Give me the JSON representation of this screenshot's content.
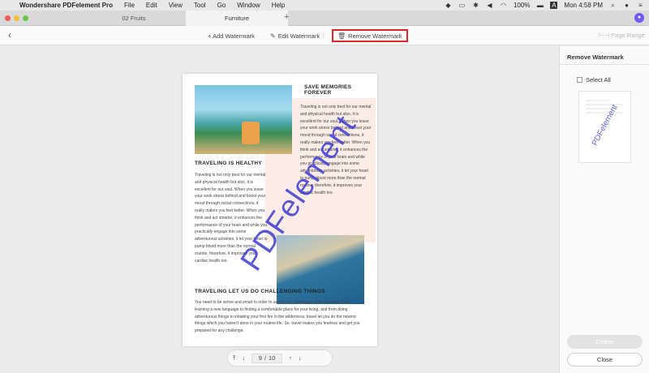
{
  "menubar": {
    "app_name": "Wondershare PDFelement Pro",
    "items": [
      "File",
      "Edit",
      "View",
      "Tool",
      "Go",
      "Window",
      "Help"
    ],
    "battery": "100%",
    "clock": "Mon 4:58 PM",
    "input_source": "A"
  },
  "tabs": [
    {
      "label": "02 Fruits"
    },
    {
      "label": "Furniture"
    }
  ],
  "toolbar": {
    "add_watermark": "+ Add Watermark",
    "edit_watermark": "Edit Watermark",
    "remove_watermark": "Remove Watermark",
    "page_range": "Page Range"
  },
  "document": {
    "save_memories": "SAVE MEMORIES FOREVER",
    "right_text": "Traveling is not only best for our mental and physical health but also, it is excellent for our soul. When you leave your work stress behind and boost your mood through social connections, it really makes you feel better. When you think and act smarter, it enhances the performance of your brain and while you practically engage into some adventurous activities, it let your heart to pump blood more than the normal routine, therefore, it improves your cardiac health too.",
    "healthy_heading": "TRAVELING IS HEALTHY",
    "left_text": "Traveling is not only best for our mental and physical health but also, it is excellent for our soul. When you leave your work stress behind and boost your mood through social connections, it really makes you feel better. When you think and act smarter, it enhances the performance of your brain and while you practically engage into some adventurous activities, it let your heart to pump blood more than the normal routine, therefore, it improves your cardiac health too.",
    "challenge_heading": "TRAVELING LET US DO CHALLENGING THINGS",
    "bottom_text": "You need to be active and smart in order to accept the challenges while traveling. From learning a new language to finding a comfortable place for your living, and from doing adventurous things to initiating your first fire in the wilderness, travel let you do the newest things which you haven't done in your routine life. So, travel makes you fearless and get you prepared for any challenge.",
    "watermark": "PDFelement"
  },
  "pagenav": {
    "current_page": "9",
    "separator": "/",
    "total_pages": "10"
  },
  "panel": {
    "title": "Remove Watermark",
    "select_all": "Select All",
    "thumb_watermark": "PDFelement",
    "delete_label": "Delete",
    "close_label": "Close"
  },
  "colors": {
    "highlight_border": "#e0262b",
    "watermark": "#3c3cd2",
    "avatar": "#6b5cf5"
  }
}
